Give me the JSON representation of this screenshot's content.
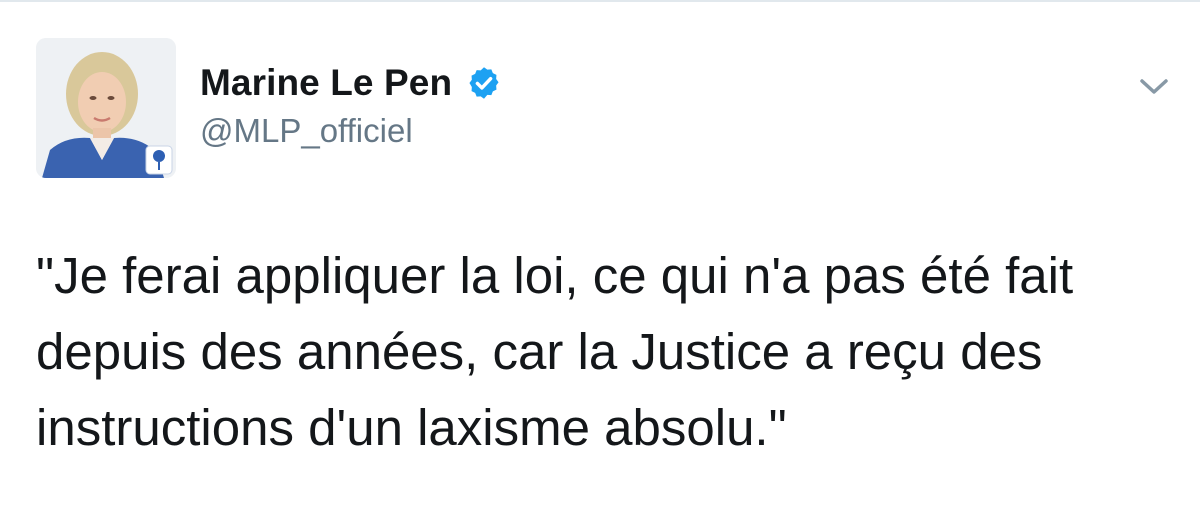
{
  "tweet": {
    "author": {
      "display_name": "Marine Le Pen",
      "handle": "@MLP_officiel",
      "verified": true,
      "avatar_icon": "profile-photo",
      "badge_icon": "verified-badge-icon"
    },
    "text": "\"Je ferai appliquer la loi, ce qui n'a pas été fait\ndepuis des années, car la Justice a reçu des\ninstructions d'un laxisme absolu.\"",
    "menu_icon": "chevron-down-icon"
  },
  "colors": {
    "text": "#14171a",
    "secondary_text": "#657786",
    "verified_blue": "#1da1f2",
    "chevron": "#8899a6",
    "divider": "#e1e8ed"
  }
}
